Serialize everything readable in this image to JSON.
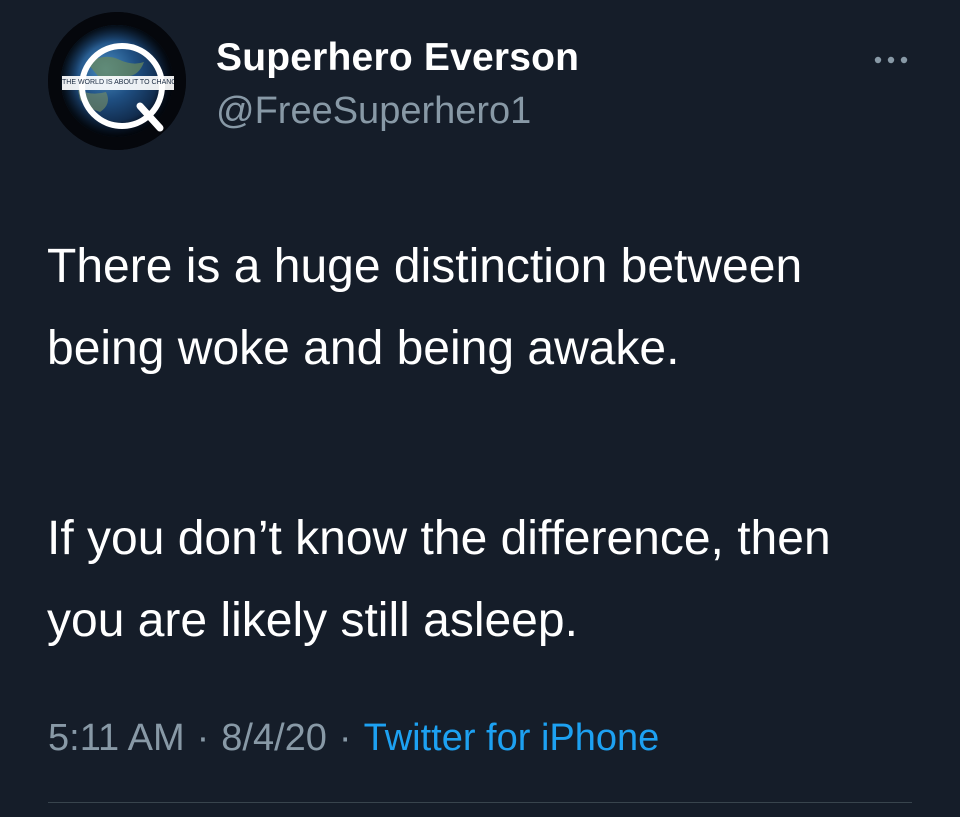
{
  "tweet": {
    "avatar": {
      "badge_text": "THE WORLD IS ABOUT TO CHANGE",
      "letter": "Q"
    },
    "display_name": "Superhero Everson",
    "handle": "@FreeSuperhero1",
    "paragraphs": [
      "There is a huge distinction between being woke and being awake.",
      "If you don’t know the difference, then you are likely still asleep."
    ],
    "time": "5:11 AM",
    "separator": "·",
    "date": "8/4/20",
    "source": "Twitter for iPhone",
    "more_icon": "more-horizontal-icon"
  },
  "colors": {
    "background": "#151d29",
    "text_primary": "#ffffff",
    "text_secondary": "#8899a6",
    "link": "#1da1f2",
    "divider": "#38444d"
  }
}
